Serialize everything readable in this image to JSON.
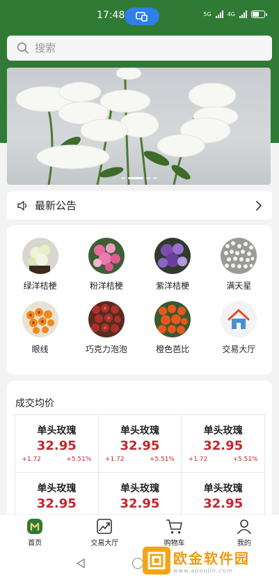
{
  "status_bar": {
    "time": "17:48",
    "signal_1_label": "5G",
    "signal_2_label": "4G"
  },
  "search": {
    "placeholder": "搜索"
  },
  "banner": {
    "slide_count": 4,
    "active_slide": 2
  },
  "notice": {
    "label": "最新公告"
  },
  "categories": [
    {
      "label": "绿洋桔梗",
      "icon": "green-eustoma-photo"
    },
    {
      "label": "粉洋桔梗",
      "icon": "pink-eustoma-photo"
    },
    {
      "label": "紫洋桔梗",
      "icon": "purple-eustoma-photo"
    },
    {
      "label": "满天星",
      "icon": "babys-breath-photo"
    },
    {
      "label": "眼线",
      "icon": "eyeliner-rose-photo"
    },
    {
      "label": "巧克力泡泡",
      "icon": "chocolate-bubble-photo"
    },
    {
      "label": "橙色芭比",
      "icon": "orange-barbie-photo"
    },
    {
      "label": "交易大厅",
      "icon": "house-icon"
    }
  ],
  "prices": {
    "title": "成交均价",
    "items": [
      {
        "name": "单头玫瑰",
        "price": "32.95",
        "change": "+1.72",
        "pct": "+5.51%"
      },
      {
        "name": "单头玫瑰",
        "price": "32.95",
        "change": "+1.72",
        "pct": "+5.51%"
      },
      {
        "name": "单头玫瑰",
        "price": "32.95",
        "change": "+1.72",
        "pct": "+5.51%"
      },
      {
        "name": "单头玫瑰",
        "price": "32.95",
        "change": "",
        "pct": ""
      },
      {
        "name": "单头玫瑰",
        "price": "32.95",
        "change": "",
        "pct": ""
      },
      {
        "name": "单头玫瑰",
        "price": "32.95",
        "change": "",
        "pct": ""
      }
    ]
  },
  "tabbar": [
    {
      "label": "首页",
      "icon": "home-icon",
      "active": true
    },
    {
      "label": "交易大厅",
      "icon": "trend-chart-icon",
      "active": false
    },
    {
      "label": "购物车",
      "icon": "cart-icon",
      "active": false
    },
    {
      "label": "我的",
      "icon": "person-icon",
      "active": false
    }
  ],
  "watermark": {
    "name": "欧金软件园",
    "url": "www.apoujin.com"
  },
  "colors": {
    "brand_green": "#2f7a35",
    "price_red": "#c3252d",
    "status_pill_blue": "#2f7fe9"
  }
}
